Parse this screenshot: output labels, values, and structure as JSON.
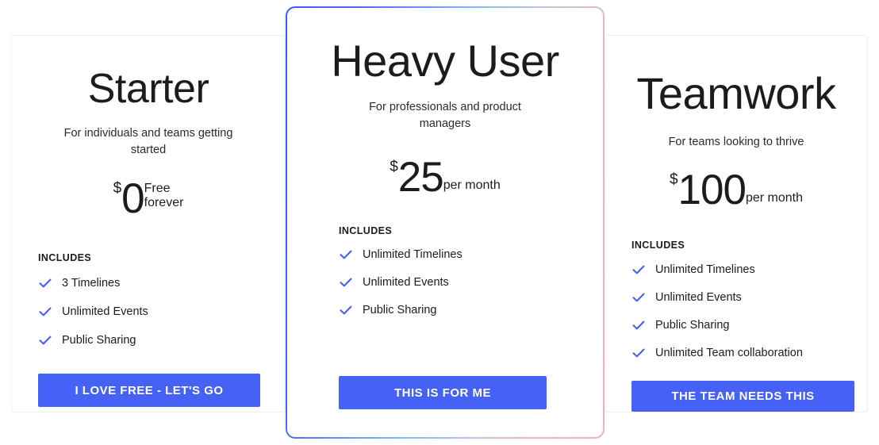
{
  "theme": {
    "page_background": "#ffffff",
    "text_color": "#1c1c1e",
    "button_color": "#4661f5",
    "button_text_color": "#ffffff",
    "check_color": "#4661f5",
    "card_border_color": "#f0f0f1",
    "featured_border_gradient_start": "#3c5cf5",
    "featured_border_gradient_mid": "#7fc0f0",
    "featured_border_gradient_end": "#eeb1c0"
  },
  "plans": [
    {
      "id": "starter",
      "name": "Starter",
      "tagline": "For individuals and teams getting started",
      "currency": "$",
      "amount": "0",
      "period": "Free\nforever",
      "includes_label": "INCLUDES",
      "features": [
        "3 Timelines",
        "Unlimited Events",
        "Public Sharing"
      ],
      "cta_label": "I LOVE FREE - LET'S GO",
      "featured": false
    },
    {
      "id": "heavy-user",
      "name": "Heavy User",
      "tagline": "For professionals and product managers",
      "currency": "$",
      "amount": "25",
      "period": "per month",
      "includes_label": "INCLUDES",
      "features": [
        "Unlimited Timelines",
        "Unlimited Events",
        "Public Sharing"
      ],
      "cta_label": "THIS IS FOR ME",
      "featured": true
    },
    {
      "id": "teamwork",
      "name": "Teamwork",
      "tagline": "For teams looking to thrive",
      "currency": "$",
      "amount": "100",
      "period": "per month",
      "includes_label": "INCLUDES",
      "features": [
        "Unlimited Timelines",
        "Unlimited Events",
        "Public Sharing",
        "Unlimited Team collaboration"
      ],
      "cta_label": "THE TEAM NEEDS THIS",
      "featured": false
    }
  ],
  "icons": {
    "check": "check-icon"
  }
}
